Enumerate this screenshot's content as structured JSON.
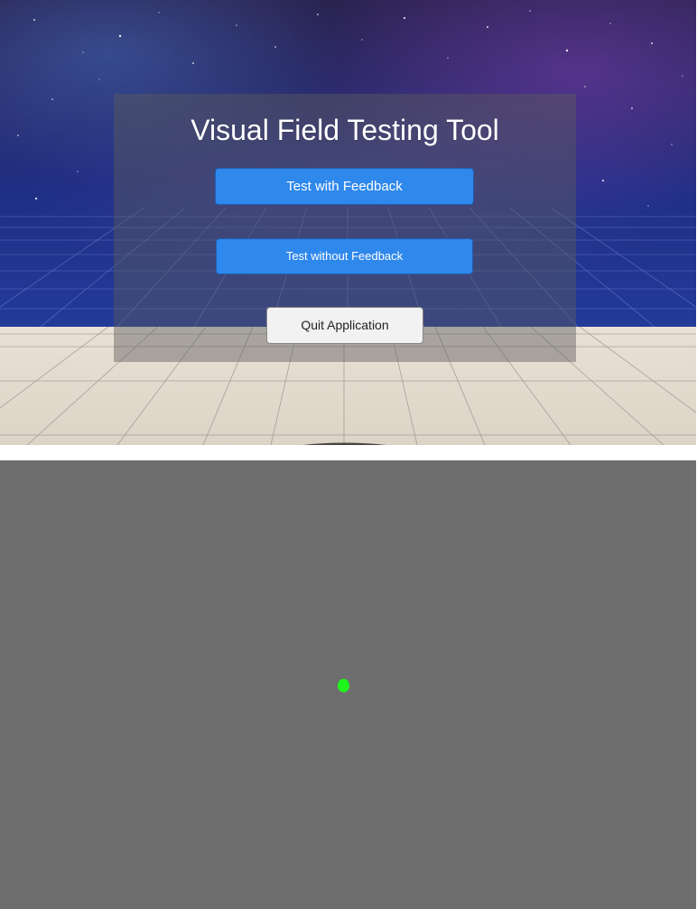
{
  "menu": {
    "title": "Visual Field Testing Tool",
    "buttons": {
      "test_with_feedback": "Test with Feedback",
      "test_without_feedback": "Test without Feedback",
      "quit": "Quit Application"
    }
  },
  "colors": {
    "primary_button": "#2f88ec",
    "secondary_button": "#f2f2f2",
    "test_background": "#6e6e6e",
    "fixation_dot": "#1df51d"
  },
  "icons": {
    "fixation": "fixation-dot"
  }
}
